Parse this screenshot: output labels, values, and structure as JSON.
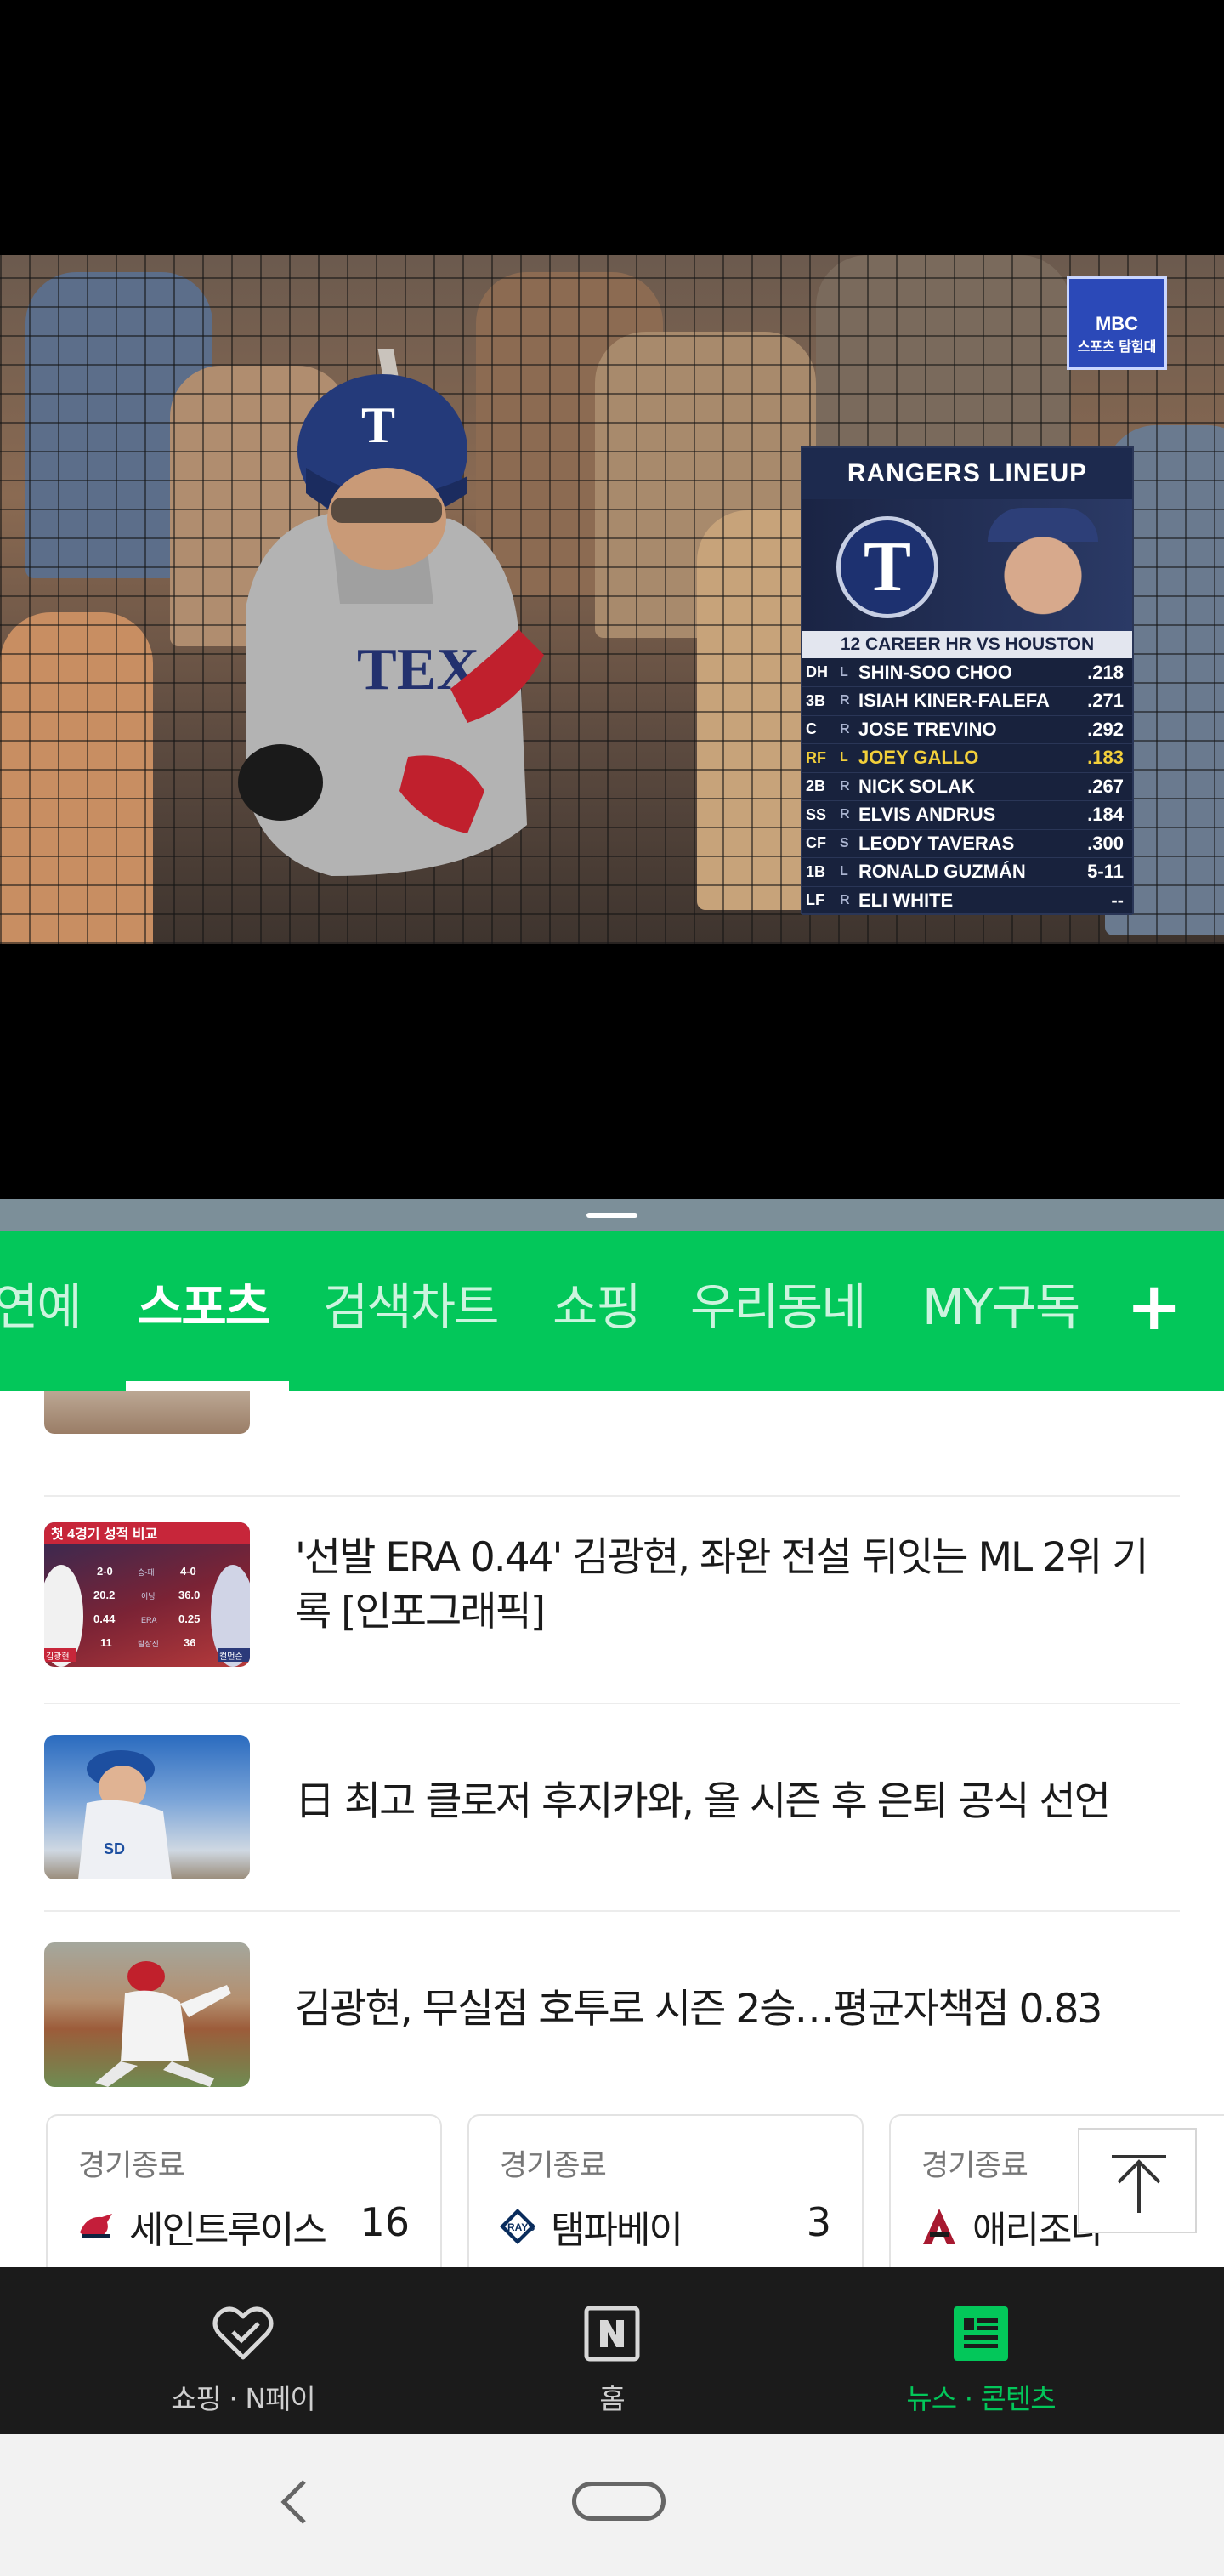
{
  "video": {
    "broadcaster_badge": {
      "line1": "MBC",
      "line2": "스포츠 탐험대"
    },
    "lineup": {
      "title": "RANGERS LINEUP",
      "logo_letter": "T",
      "subtitle": "12 CAREER HR VS HOUSTON",
      "rows": [
        {
          "pos": "DH",
          "hand": "L",
          "name": "SHIN-SOO CHOO",
          "value": ".218",
          "highlight": false
        },
        {
          "pos": "3B",
          "hand": "R",
          "name": "ISIAH KINER-FALEFA",
          "value": ".271",
          "highlight": false
        },
        {
          "pos": "C",
          "hand": "R",
          "name": "JOSE TREVINO",
          "value": ".292",
          "highlight": false
        },
        {
          "pos": "RF",
          "hand": "L",
          "name": "JOEY GALLO",
          "value": ".183",
          "highlight": true
        },
        {
          "pos": "2B",
          "hand": "R",
          "name": "NICK SOLAK",
          "value": ".267",
          "highlight": false
        },
        {
          "pos": "SS",
          "hand": "R",
          "name": "ELVIS ANDRUS",
          "value": ".184",
          "highlight": false
        },
        {
          "pos": "CF",
          "hand": "S",
          "name": "LEODY TAVERAS",
          "value": ".300",
          "highlight": false
        },
        {
          "pos": "1B",
          "hand": "L",
          "name": "RONALD GUZMÁN",
          "value": "5-11",
          "highlight": false
        },
        {
          "pos": "LF",
          "hand": "R",
          "name": "ELI WHITE",
          "value": "--",
          "highlight": false
        }
      ]
    }
  },
  "tabs": [
    {
      "label": "연예",
      "active": false
    },
    {
      "label": "스포츠",
      "active": true
    },
    {
      "label": "검색차트",
      "active": false
    },
    {
      "label": "쇼핑",
      "active": false
    },
    {
      "label": "우리동네",
      "active": false
    },
    {
      "label": "MY구독",
      "active": false
    }
  ],
  "tab_add_label": "+",
  "news": [
    {
      "headline": "'선발 ERA 0.44' 김광현, 좌완 전설 뒤잇는 ML 2위 기록 [인포그래픽]",
      "thumb_text": {
        "banner": "첫 4경기 성적 비교",
        "left": [
          "2-0",
          "20.2",
          "0.44",
          "11"
        ],
        "mid": [
          "승-패",
          "이닝",
          "ERA",
          "탈삼진"
        ],
        "right": [
          "4-0",
          "36.0",
          "0.25",
          "36"
        ],
        "tag_left": "김광현",
        "tag_right": "컬먼슨"
      }
    },
    {
      "headline": "日 최고 클로저 후지카와, 올 시즌 후 은퇴 공식 선언"
    },
    {
      "headline": "김광현, 무실점 호투로 시즌 2승…평균자책점 0.83"
    }
  ],
  "scores": [
    {
      "status": "경기종료",
      "team": "세인트루이스",
      "score": "16",
      "logo": "cardinals-logo"
    },
    {
      "status": "경기종료",
      "team": "탬파베이",
      "score": "3",
      "logo": "rays-logo"
    },
    {
      "status": "경기종료",
      "team": "애리조나",
      "score": "",
      "logo": "diamondbacks-logo"
    }
  ],
  "bottom_nav": [
    {
      "label": "쇼핑 · N페이",
      "icon": "heart-check-icon",
      "active": false
    },
    {
      "label": "홈",
      "icon": "naver-n-icon",
      "active": false
    },
    {
      "label": "뉴스 · 콘텐츠",
      "icon": "news-icon",
      "active": true
    }
  ],
  "colors": {
    "brand_green": "#03c75a",
    "nav_dark": "#1b1b1b",
    "highlight_yellow": "#f2cf3a"
  }
}
